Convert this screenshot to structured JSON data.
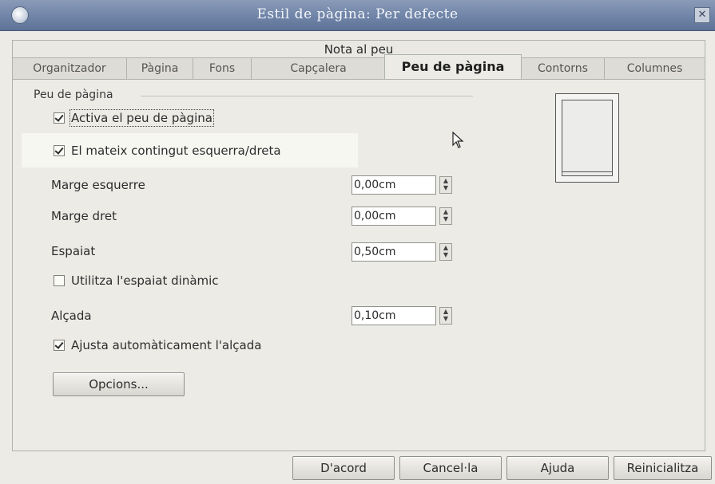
{
  "window": {
    "title": "Estil de pàgina: Per defecte"
  },
  "tabs_row1": [
    "Nota al peu"
  ],
  "tabs_row2": [
    "Organitzador",
    "Pàgina",
    "Fons",
    "Capçalera",
    "Peu de pàgina",
    "Contorns",
    "Columnes"
  ],
  "active_tab": "Peu de pàgina",
  "footer_group": {
    "title": "Peu de pàgina",
    "activate": {
      "label": "Activa el peu de pàgina",
      "checked": true
    },
    "same_content": {
      "label": "El mateix contingut esquerra/dreta",
      "checked": true
    },
    "left_margin": {
      "label": "Marge esquerre",
      "value": "0,00cm"
    },
    "right_margin": {
      "label": "Marge dret",
      "value": "0,00cm"
    },
    "spacing": {
      "label": "Espaiat",
      "value": "0,50cm"
    },
    "dynamic_spacing": {
      "label": "Utilitza l'espaiat dinàmic",
      "checked": false
    },
    "height": {
      "label": "Alçada",
      "value": "0,10cm"
    },
    "autofit_height": {
      "label": "Ajusta automàticament l'alçada",
      "checked": true
    },
    "options_button": "Opcions..."
  },
  "buttons": {
    "ok": "D'acord",
    "cancel": "Cancel·la",
    "help": "Ajuda",
    "reset": "Reinicialitza"
  },
  "icons": {
    "close": "close-icon",
    "app": "app-icon",
    "spin": "spin-arrows-icon",
    "cursor": "mouse-pointer-icon"
  }
}
